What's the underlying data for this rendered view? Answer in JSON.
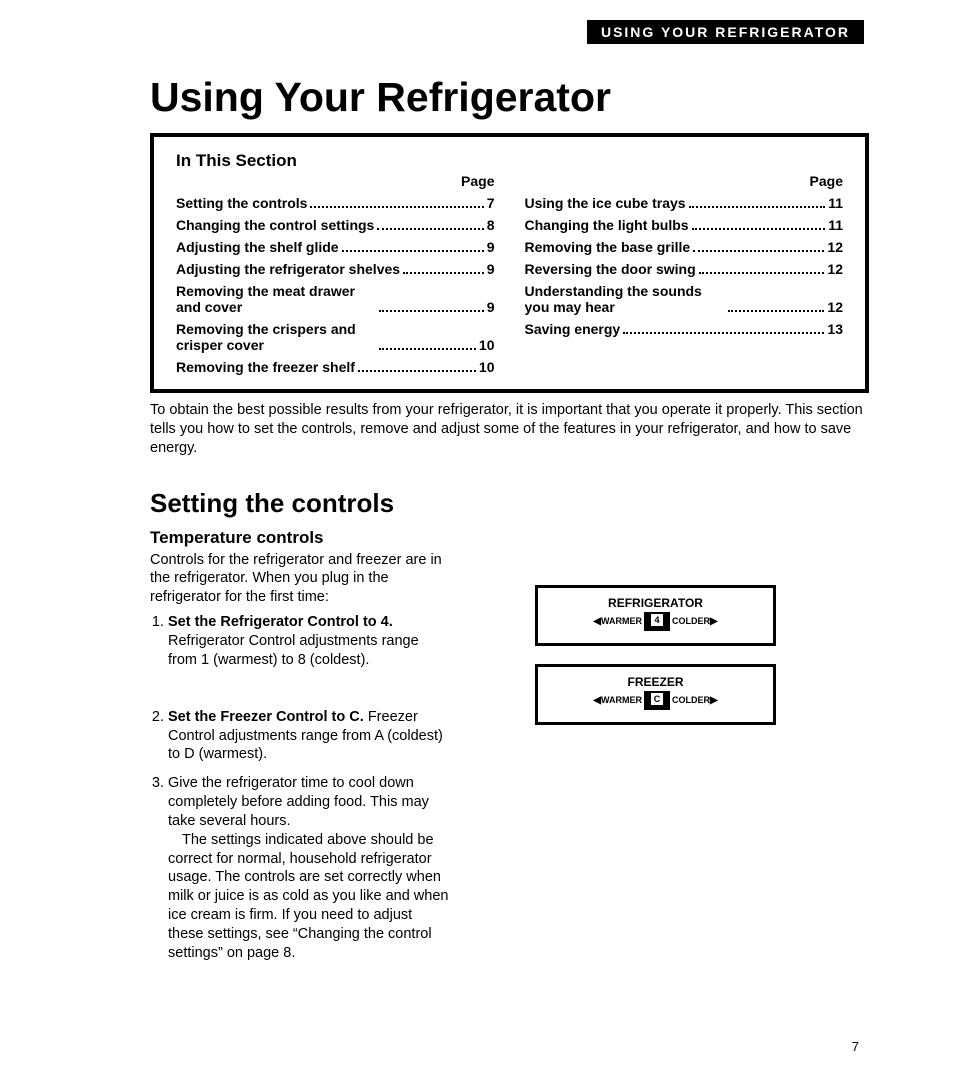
{
  "header_bar": "USING YOUR REFRIGERATOR",
  "title": "Using Your Refrigerator",
  "toc": {
    "heading": "In This Section",
    "page_label": "Page",
    "left": [
      {
        "label": "Setting the controls",
        "page": "7"
      },
      {
        "label": "Changing the control settings",
        "page": "8"
      },
      {
        "label": "Adjusting the shelf glide",
        "page": "9"
      },
      {
        "label": "Adjusting the refrigerator shelves",
        "page": "9"
      },
      {
        "label": "Removing the meat drawer and cover",
        "page": "9"
      },
      {
        "label": "Removing the crispers and crisper cover",
        "page": "10"
      },
      {
        "label": "Removing the freezer shelf",
        "page": "10"
      }
    ],
    "right": [
      {
        "label": "Using the ice cube trays",
        "page": "11"
      },
      {
        "label": "Changing the light bulbs",
        "page": "11"
      },
      {
        "label": "Removing the base grille",
        "page": "12"
      },
      {
        "label": "Reversing the door swing",
        "page": "12"
      },
      {
        "label": "Understanding the sounds you may hear",
        "page": "12"
      },
      {
        "label": "Saving energy",
        "page": "13"
      }
    ]
  },
  "intro": "To obtain the best possible results from your refrigerator, it is important that you operate it properly. This section tells you how to set the controls, remove and adjust some of the features in your refrigerator, and how to save energy.",
  "setting": {
    "heading": "Setting the controls",
    "sub": "Temperature controls",
    "lead": "Controls for the refrigerator and freezer are in the refrigerator. When you plug in the refrigerator for the first time:",
    "step1_head": "Set the Refrigerator Control to 4.",
    "step1_body": "Refrigerator Control adjustments range from 1 (warmest) to 8 (coldest).",
    "step2_head": "Set the Freezer Control to C.",
    "step2_body": "Freezer Control adjustments range from A (coldest) to D (warmest).",
    "step3_body_a": "Give the refrigerator time to cool down completely before adding food. This may take several hours.",
    "step3_body_b": "The settings indicated above should be correct for normal, household refrigerator usage. The controls are set correctly when milk or juice is as cold as you like and when ice cream is firm. If you need to adjust these settings, see “Changing the control settings” on page 8."
  },
  "dials": {
    "refrigerator": {
      "title": "REFRIGERATOR",
      "warmer": "WARMER",
      "colder": "COLDER",
      "value": "4"
    },
    "freezer": {
      "title": "FREEZER",
      "warmer": "WARMER",
      "colder": "COLDER",
      "value": "C"
    }
  },
  "page_number": "7"
}
